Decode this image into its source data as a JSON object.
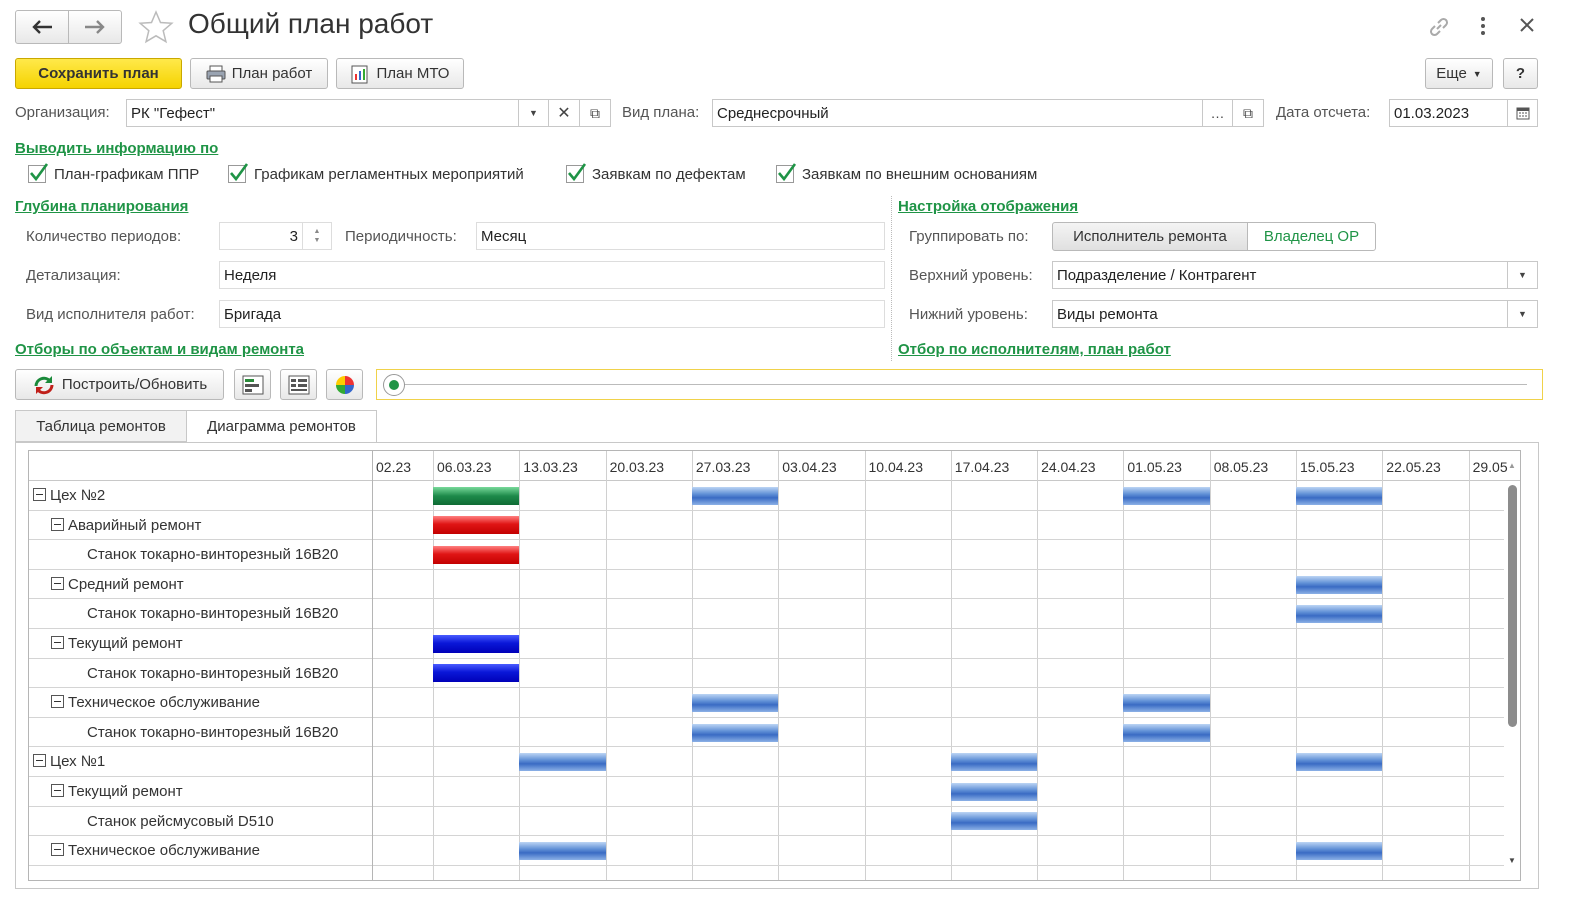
{
  "window": {
    "title": "Общий план работ"
  },
  "toolbar": {
    "save_label": "Сохранить план",
    "plan_work_label": "План работ",
    "plan_mto_label": "План МТО",
    "more_label": "Еще",
    "help_label": "?"
  },
  "form": {
    "org_label": "Организация:",
    "org_value": "РК \"Гефест\"",
    "plan_type_label": "Вид плана:",
    "plan_type_value": "Среднесрочный",
    "date_label": "Дата отсчета:",
    "date_value": "01.03.2023"
  },
  "output_info": {
    "link": "Выводить информацию по",
    "checks": [
      {
        "label": "План-графикам ППР",
        "checked": true
      },
      {
        "label": "Графикам регламентных мероприятий",
        "checked": true
      },
      {
        "label": "Заявкам по дефектам",
        "checked": true
      },
      {
        "label": "Заявкам по внешним основаниям",
        "checked": true
      }
    ]
  },
  "planning_depth": {
    "link": "Глубина планирования",
    "periods_label": "Количество периодов:",
    "periods_value": "3",
    "periodicity_label": "Периодичность:",
    "periodicity_value": "Месяц",
    "detail_label": "Детализация:",
    "detail_value": "Неделя",
    "executor_type_label": "Вид исполнителя работ:",
    "executor_type_value": "Бригада"
  },
  "display_settings": {
    "link": "Настройка отображения",
    "group_label": "Группировать по:",
    "group_options": [
      "Исполнитель ремонта",
      "Владелец ОР"
    ],
    "upper_label": "Верхний уровень:",
    "upper_value": "Подразделение / Контрагент",
    "lower_label": "Нижний уровень:",
    "lower_value": "Виды ремонта"
  },
  "filters": {
    "objects_link": "Отборы по объектам и видам ремонта",
    "executors_link": "Отбор  по исполнителям, план работ"
  },
  "actions": {
    "build_label": "Построить/Обновить"
  },
  "tabs": [
    {
      "label": "Таблица ремонтов",
      "active": false
    },
    {
      "label": "Диаграмма ремонтов",
      "active": true
    }
  ],
  "colors": {
    "accent_green": "#1f9446",
    "save_yellow": "#f5d300"
  },
  "gantt": {
    "dates": [
      "02.23",
      "06.03.23",
      "13.03.23",
      "20.03.23",
      "27.03.23",
      "03.04.23",
      "10.04.23",
      "17.04.23",
      "24.04.23",
      "01.05.23",
      "08.05.23",
      "15.05.23",
      "22.05.23",
      "29.05"
    ],
    "rows": [
      {
        "name": "Цех №2",
        "level": 0,
        "bars": [
          {
            "week": 1,
            "color": "green"
          },
          {
            "week": 4,
            "color": "lblue"
          },
          {
            "week": 9,
            "color": "lblue"
          },
          {
            "week": 11,
            "color": "lblue"
          }
        ]
      },
      {
        "name": "Аварийный ремонт",
        "level": 1,
        "bars": [
          {
            "week": 1,
            "color": "red"
          }
        ]
      },
      {
        "name": "Станок токарно-винторезный 16В20",
        "level": 2,
        "bars": [
          {
            "week": 1,
            "color": "red"
          }
        ]
      },
      {
        "name": "Средний ремонт",
        "level": 1,
        "bars": [
          {
            "week": 11,
            "color": "lblue"
          }
        ]
      },
      {
        "name": "Станок токарно-винторезный 16В20",
        "level": 2,
        "bars": [
          {
            "week": 11,
            "color": "lblue"
          }
        ]
      },
      {
        "name": "Текущий ремонт",
        "level": 1,
        "bars": [
          {
            "week": 1,
            "color": "dblue"
          }
        ]
      },
      {
        "name": "Станок токарно-винторезный 16В20",
        "level": 2,
        "bars": [
          {
            "week": 1,
            "color": "dblue"
          }
        ]
      },
      {
        "name": "Техническое обслуживание",
        "level": 1,
        "bars": [
          {
            "week": 4,
            "color": "lblue"
          },
          {
            "week": 9,
            "color": "lblue"
          }
        ]
      },
      {
        "name": "Станок токарно-винторезный 16В20",
        "level": 2,
        "bars": [
          {
            "week": 4,
            "color": "lblue"
          },
          {
            "week": 9,
            "color": "lblue"
          }
        ]
      },
      {
        "name": "Цех №1",
        "level": 0,
        "bars": [
          {
            "week": 2,
            "color": "lblue"
          },
          {
            "week": 7,
            "color": "lblue"
          },
          {
            "week": 11,
            "color": "lblue"
          }
        ]
      },
      {
        "name": "Текущий ремонт",
        "level": 1,
        "bars": [
          {
            "week": 7,
            "color": "lblue"
          }
        ]
      },
      {
        "name": "Станок рейсмусовый D510",
        "level": 2,
        "bars": [
          {
            "week": 7,
            "color": "lblue"
          }
        ]
      },
      {
        "name": "Техническое обслуживание",
        "level": 1,
        "bars": [
          {
            "week": 2,
            "color": "lblue"
          },
          {
            "week": 11,
            "color": "lblue"
          }
        ]
      }
    ]
  }
}
